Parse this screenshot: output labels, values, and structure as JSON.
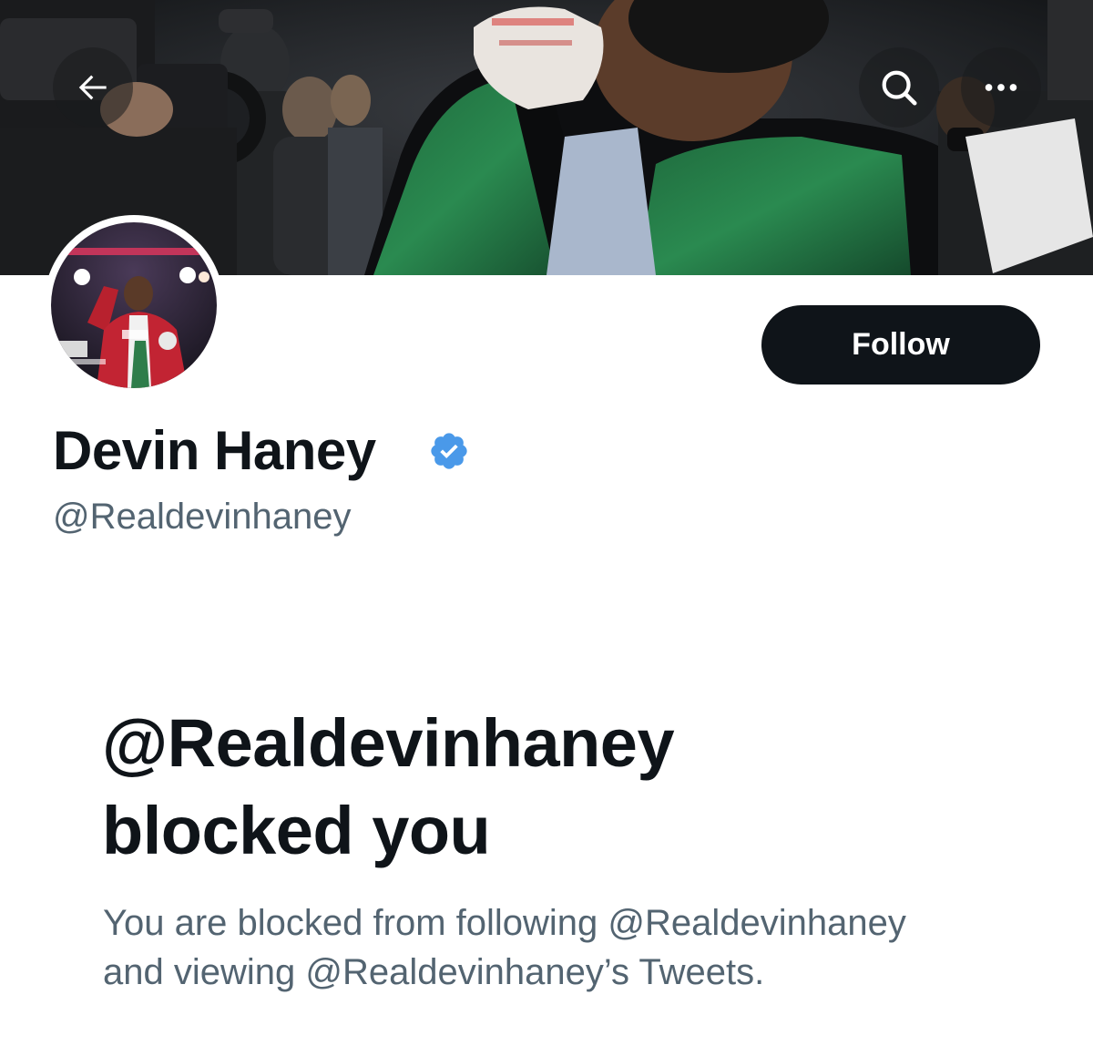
{
  "header": {
    "back_icon": "arrow-left-icon",
    "search_icon": "search-icon",
    "more_icon": "more-horizontal-icon"
  },
  "profile": {
    "display_name": "Devin Haney",
    "handle": "@Realdevinhaney",
    "verified": true,
    "verified_color": "#4a99e9",
    "follow_label": "Follow"
  },
  "blocked": {
    "title_line1": "@Realdevinhaney",
    "title_line2": "blocked you",
    "desc_line1": "You are blocked from following @Realdevinhaney",
    "desc_line2": "and viewing @Realdevinhaney’s Tweets."
  },
  "colors": {
    "text_primary": "#0f1419",
    "text_secondary": "#536471",
    "button_bg": "#0f1419",
    "button_text": "#ffffff"
  }
}
